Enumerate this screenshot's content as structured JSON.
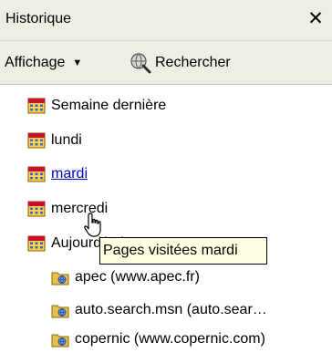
{
  "panel": {
    "title": "Historique",
    "close_glyph": "✕"
  },
  "toolbar": {
    "view_label": "Affichage",
    "view_caret": "▼",
    "search_label": "Rechercher",
    "search_icon": "search-globe-icon"
  },
  "history": {
    "groups": [
      {
        "label": "Semaine dernière",
        "icon": "calendar-icon"
      },
      {
        "label": "lundi",
        "icon": "calendar-icon"
      },
      {
        "label": "mardi",
        "icon": "calendar-icon",
        "hovered": true
      },
      {
        "label": "mercredi",
        "icon": "calendar-icon"
      },
      {
        "label": "Aujourd'hui",
        "icon": "calendar-icon"
      }
    ],
    "sites": [
      {
        "label": "apec (www.apec.fr)",
        "icon": "folder-icon"
      },
      {
        "label": "auto.search.msn (auto.sear…",
        "icon": "folder-icon"
      },
      {
        "label": "copernic (www.copernic.com)",
        "icon": "folder-icon"
      }
    ]
  },
  "tooltip": {
    "text": "Pages visitées mardi"
  },
  "colors": {
    "panel_bg": "#efeee5",
    "link": "#0000cc",
    "tooltip_bg": "#ffffe1",
    "calendar_header": "#c8102e",
    "calendar_body": "#ffd24a",
    "folder": "#e8c24a"
  }
}
